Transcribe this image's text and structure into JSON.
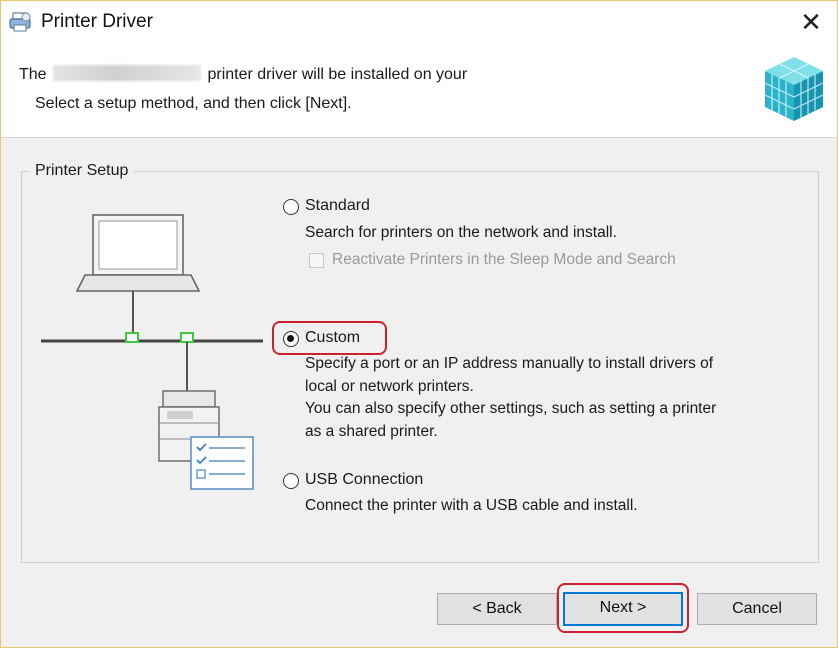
{
  "window": {
    "title": "Printer Driver",
    "close_glyph": "✕",
    "app_icon": "printer-driver-icon"
  },
  "header": {
    "line1_prefix": "The",
    "line1_suffix": "printer driver will be installed on your",
    "line2": "Select a setup method, and then click [Next].",
    "graphic": "cube-stack-icon"
  },
  "printer_setup": {
    "title": "Printer Setup",
    "options": [
      {
        "label": "Standard",
        "selected": false,
        "description": [
          "Search for printers on the network and install."
        ],
        "sub_checkbox": {
          "label": "Reactivate Printers in the Sleep Mode and Search",
          "checked": false,
          "enabled": false
        }
      },
      {
        "label": "Custom",
        "selected": true,
        "highlighted": true,
        "description": [
          "Specify a port or an IP address manually to install drivers of",
          "local or network printers.",
          "You can also specify other settings, such as setting a printer",
          "as a shared printer."
        ]
      },
      {
        "label": "USB Connection",
        "selected": false,
        "description": [
          "Connect the printer with a USB cable and install."
        ]
      }
    ]
  },
  "buttons": {
    "back": "< Back",
    "next": "Next >",
    "cancel": "Cancel",
    "next_highlighted": true
  },
  "colors": {
    "highlight": "#d0202e",
    "default_button_border": "#0078d7",
    "cube": "#2bb3c9",
    "network_connector": "#3ec83e"
  }
}
